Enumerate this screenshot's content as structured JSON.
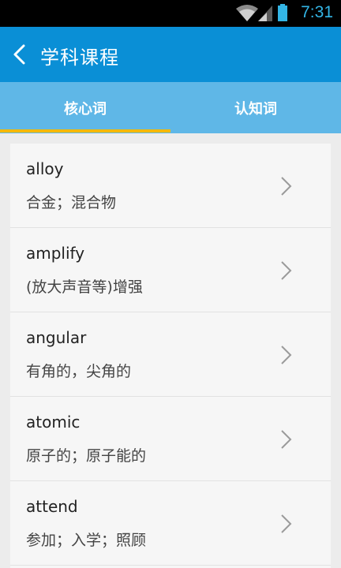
{
  "status_bar": {
    "time": "7:31",
    "icons": [
      "wifi-icon",
      "signal-icon",
      "battery-icon"
    ]
  },
  "app_bar": {
    "title": "学科课程",
    "back_icon": "chevron-left-icon"
  },
  "tabs": [
    {
      "label": "核心词",
      "active": true
    },
    {
      "label": "认知词",
      "active": false
    }
  ],
  "words": [
    {
      "word": "alloy",
      "meaning": "合金；混合物"
    },
    {
      "word": "amplify",
      "meaning": "(放大声音等)增强"
    },
    {
      "word": "angular",
      "meaning": "有角的，尖角的"
    },
    {
      "word": "atomic",
      "meaning": "原子的；原子能的"
    },
    {
      "word": "attend",
      "meaning": "参加；入学；照顾"
    }
  ],
  "colors": {
    "app_bar": "#0a8fd6",
    "tabs": "#5fb7e7",
    "tab_indicator": "#f5b800",
    "status_time": "#33b5e5"
  }
}
